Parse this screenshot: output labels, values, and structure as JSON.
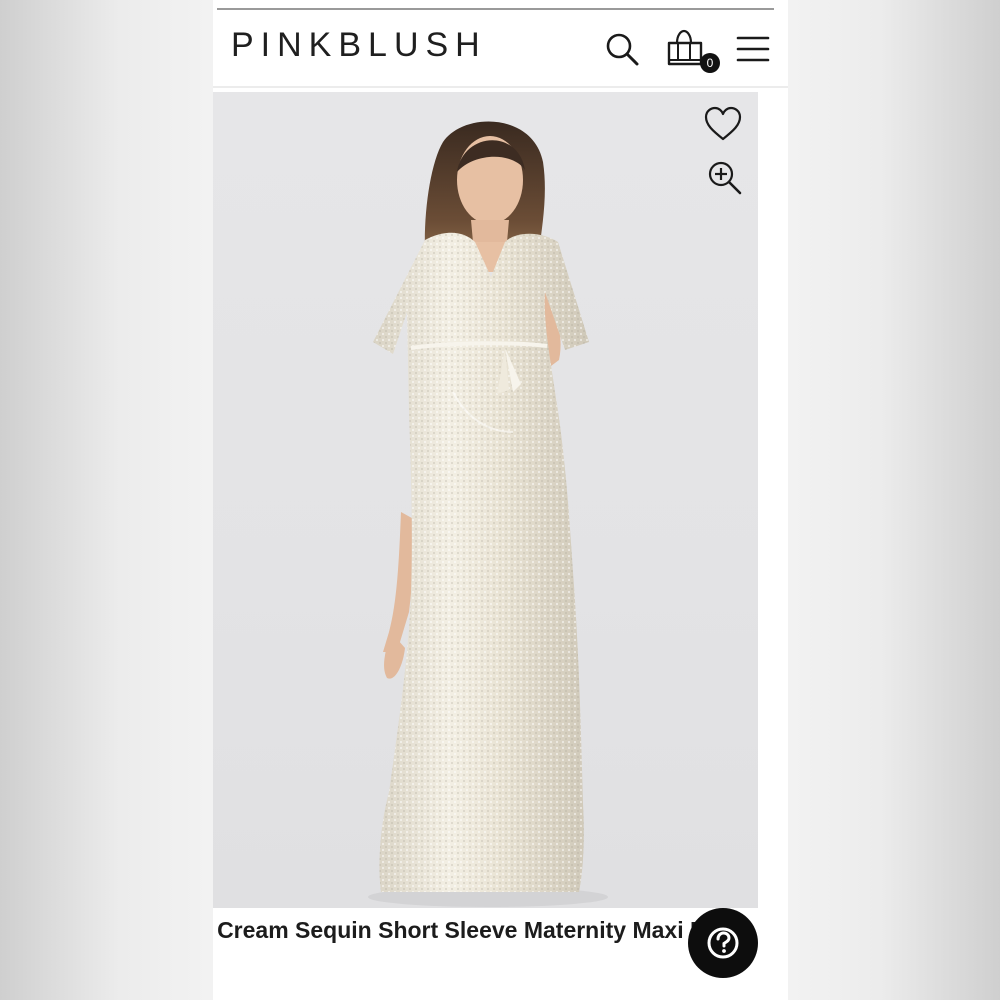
{
  "header": {
    "logo_text": "PINKBLUSH",
    "cart_count": "0",
    "icons": {
      "search": "search-icon",
      "cart": "shopping-bag-icon",
      "menu": "hamburger-menu-icon"
    }
  },
  "product": {
    "title": "Cream Sequin Short Sleeve Maternity Maxi Dress",
    "image_icons": {
      "wishlist": "heart-icon",
      "zoom": "zoom-in-icon"
    }
  },
  "help": {
    "icon": "question-mark-icon"
  },
  "colors": {
    "text": "#1c1c1c",
    "background": "#ffffff",
    "help_button": "#0d0d0d",
    "photo_background": "#e4e4e6",
    "dress": "#ebe6d9"
  }
}
